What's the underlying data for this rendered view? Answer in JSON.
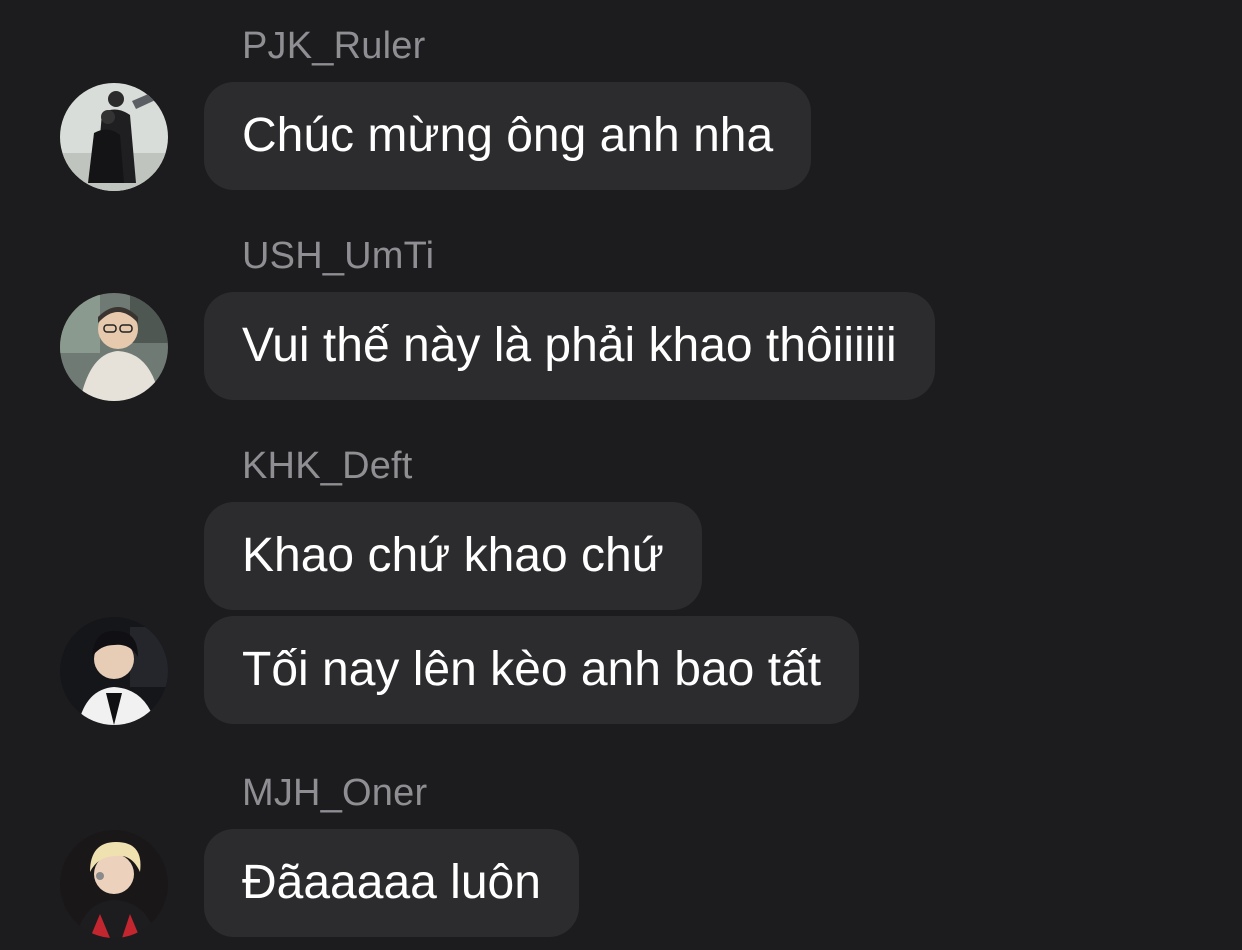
{
  "messages": [
    {
      "sender": "PJK_Ruler",
      "avatar_icon": "user-photo-avatar",
      "bubbles": [
        "Chúc mừng ông anh nha"
      ]
    },
    {
      "sender": "USH_UmTi",
      "avatar_icon": "user-photo-avatar",
      "bubbles": [
        "Vui thế này là phải khao thôiiiiii"
      ]
    },
    {
      "sender": "KHK_Deft",
      "avatar_icon": "user-photo-avatar",
      "bubbles": [
        "Khao chứ khao chứ",
        "Tối nay lên kèo anh bao tất"
      ]
    },
    {
      "sender": "MJH_Oner",
      "avatar_icon": "user-photo-avatar",
      "bubbles": [
        "Đãaaaaa luôn"
      ]
    }
  ],
  "colors": {
    "background": "#1c1c1e",
    "bubble": "#2c2c2e",
    "sender_text": "#8e8e93",
    "message_text": "#ffffff"
  }
}
